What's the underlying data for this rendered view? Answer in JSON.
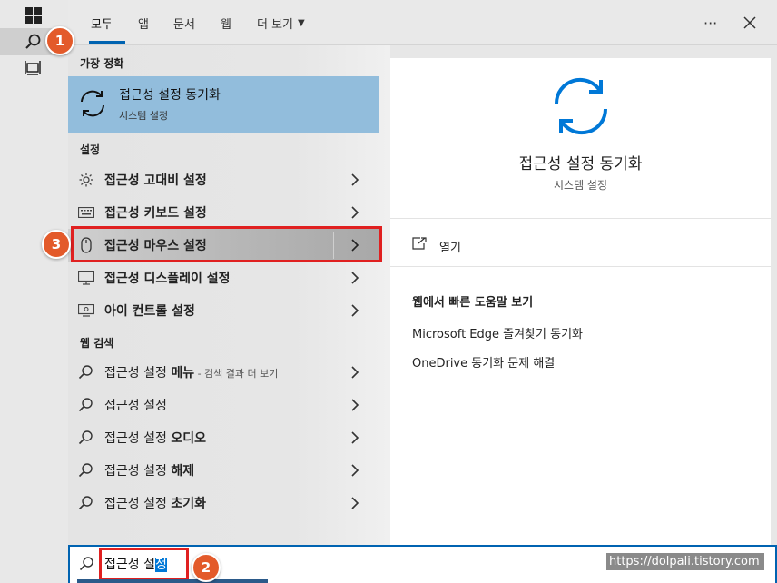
{
  "tabs": [
    {
      "label": "모두",
      "active": true
    },
    {
      "label": "앱"
    },
    {
      "label": "문서"
    },
    {
      "label": "웹"
    },
    {
      "label": "더 보기"
    }
  ],
  "more_menu": "···",
  "best_match": {
    "section": "가장 정확",
    "title": "접근성 설정 동기화",
    "subtitle": "시스템 설정",
    "icon": "sync-icon"
  },
  "settings": {
    "section": "설정",
    "items": [
      {
        "label": "접근성 고대비 설정",
        "icon": "high-contrast-icon"
      },
      {
        "label": "접근성 키보드 설정",
        "icon": "keyboard-icon"
      },
      {
        "label": "접근성 마우스 설정",
        "icon": "mouse-icon",
        "highlighted": true
      },
      {
        "label": "접근성 디스플레이 설정",
        "icon": "display-icon"
      },
      {
        "label": "아이 컨트롤 설정",
        "icon": "eye-control-icon"
      }
    ]
  },
  "web": {
    "section": "웹 검색",
    "items": [
      {
        "bold_prefix": "접근성 설정 ",
        "normal": "",
        "bold_suffix": "메뉴",
        "extra": " - 검색 결과 더 보기"
      },
      {
        "bold_prefix": "접근성 설정",
        "normal": "",
        "bold_suffix": "",
        "extra": ""
      },
      {
        "bold_prefix": "접근성 설정 ",
        "normal": "",
        "bold_suffix": "오디오",
        "extra": ""
      },
      {
        "bold_prefix": "접근성 설정 ",
        "normal": "",
        "bold_suffix": "해제",
        "extra": ""
      },
      {
        "bold_prefix": "접근성 설정 ",
        "normal": "",
        "bold_suffix": "초기화",
        "extra": ""
      }
    ]
  },
  "preview": {
    "title": "접근성 설정 동기화",
    "subtitle": "시스템 설정",
    "open_label": "열기",
    "help_title": "웹에서 빠른 도움말 보기",
    "links": [
      "Microsoft Edge 즐겨찾기 동기화",
      "OneDrive 동기화 문제 해결"
    ]
  },
  "search": {
    "typed": "접근성 설",
    "selected": "정"
  },
  "watermark": "https://dolpali.tistory.com",
  "badges": {
    "one": "1",
    "two": "2",
    "three": "3"
  },
  "colors": {
    "accent": "#0063b1",
    "badge": "#e35a2a",
    "highlight_box": "#e02020",
    "best_bg": "#92bddc"
  }
}
